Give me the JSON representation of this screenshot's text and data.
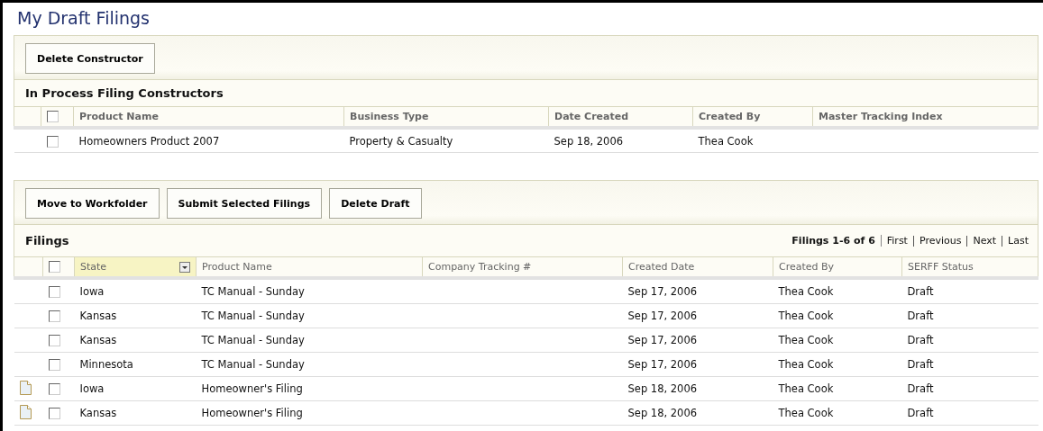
{
  "page_title": "My Draft Filings",
  "constructors": {
    "buttons": [
      "Delete Constructor"
    ],
    "title": "In Process Filing Constructors",
    "header_checked": false,
    "columns": [
      "Product Name",
      "Business Type",
      "Date Created",
      "Created By",
      "Master Tracking Index"
    ],
    "rows": [
      {
        "checked": false,
        "cells": [
          "Homeowners Product 2007",
          "Property & Casualty",
          "Sep 18, 2006",
          "Thea Cook",
          ""
        ]
      }
    ]
  },
  "filings": {
    "buttons": [
      "Move to Workfolder",
      "Submit Selected Filings",
      "Delete Draft"
    ],
    "title": "Filings",
    "pager": {
      "summary": "Filings 1-6 of 6",
      "links": [
        "First",
        "Previous",
        "Next",
        "Last"
      ]
    },
    "header_checked": false,
    "columns": [
      {
        "label": "State",
        "active": true
      },
      {
        "label": "Product Name",
        "active": false
      },
      {
        "label": "Company Tracking #",
        "active": false
      },
      {
        "label": "Created Date",
        "active": false
      },
      {
        "label": "Created By",
        "active": false
      },
      {
        "label": "SERFF Status",
        "active": false
      }
    ],
    "rows": [
      {
        "kind": "plain",
        "checked": false,
        "cells": [
          "Iowa",
          "TC Manual - Sunday",
          "",
          "Sep 17, 2006",
          "Thea Cook",
          "Draft"
        ]
      },
      {
        "kind": "plain",
        "checked": false,
        "cells": [
          "Kansas",
          "TC Manual - Sunday",
          "",
          "Sep 17, 2006",
          "Thea Cook",
          "Draft"
        ]
      },
      {
        "kind": "plain",
        "checked": false,
        "cells": [
          "Kansas",
          "TC Manual - Sunday",
          "",
          "Sep 17, 2006",
          "Thea Cook",
          "Draft"
        ]
      },
      {
        "kind": "plain",
        "checked": false,
        "cells": [
          "Minnesota",
          "TC Manual - Sunday",
          "",
          "Sep 17, 2006",
          "Thea Cook",
          "Draft"
        ]
      },
      {
        "kind": "document",
        "checked": false,
        "cells": [
          "Iowa",
          "Homeowner's Filing",
          "",
          "Sep 18, 2006",
          "Thea Cook",
          "Draft"
        ]
      },
      {
        "kind": "document",
        "checked": false,
        "cells": [
          "Kansas",
          "Homeowner's Filing",
          "",
          "Sep 18, 2006",
          "Thea Cook",
          "Draft"
        ]
      }
    ]
  }
}
